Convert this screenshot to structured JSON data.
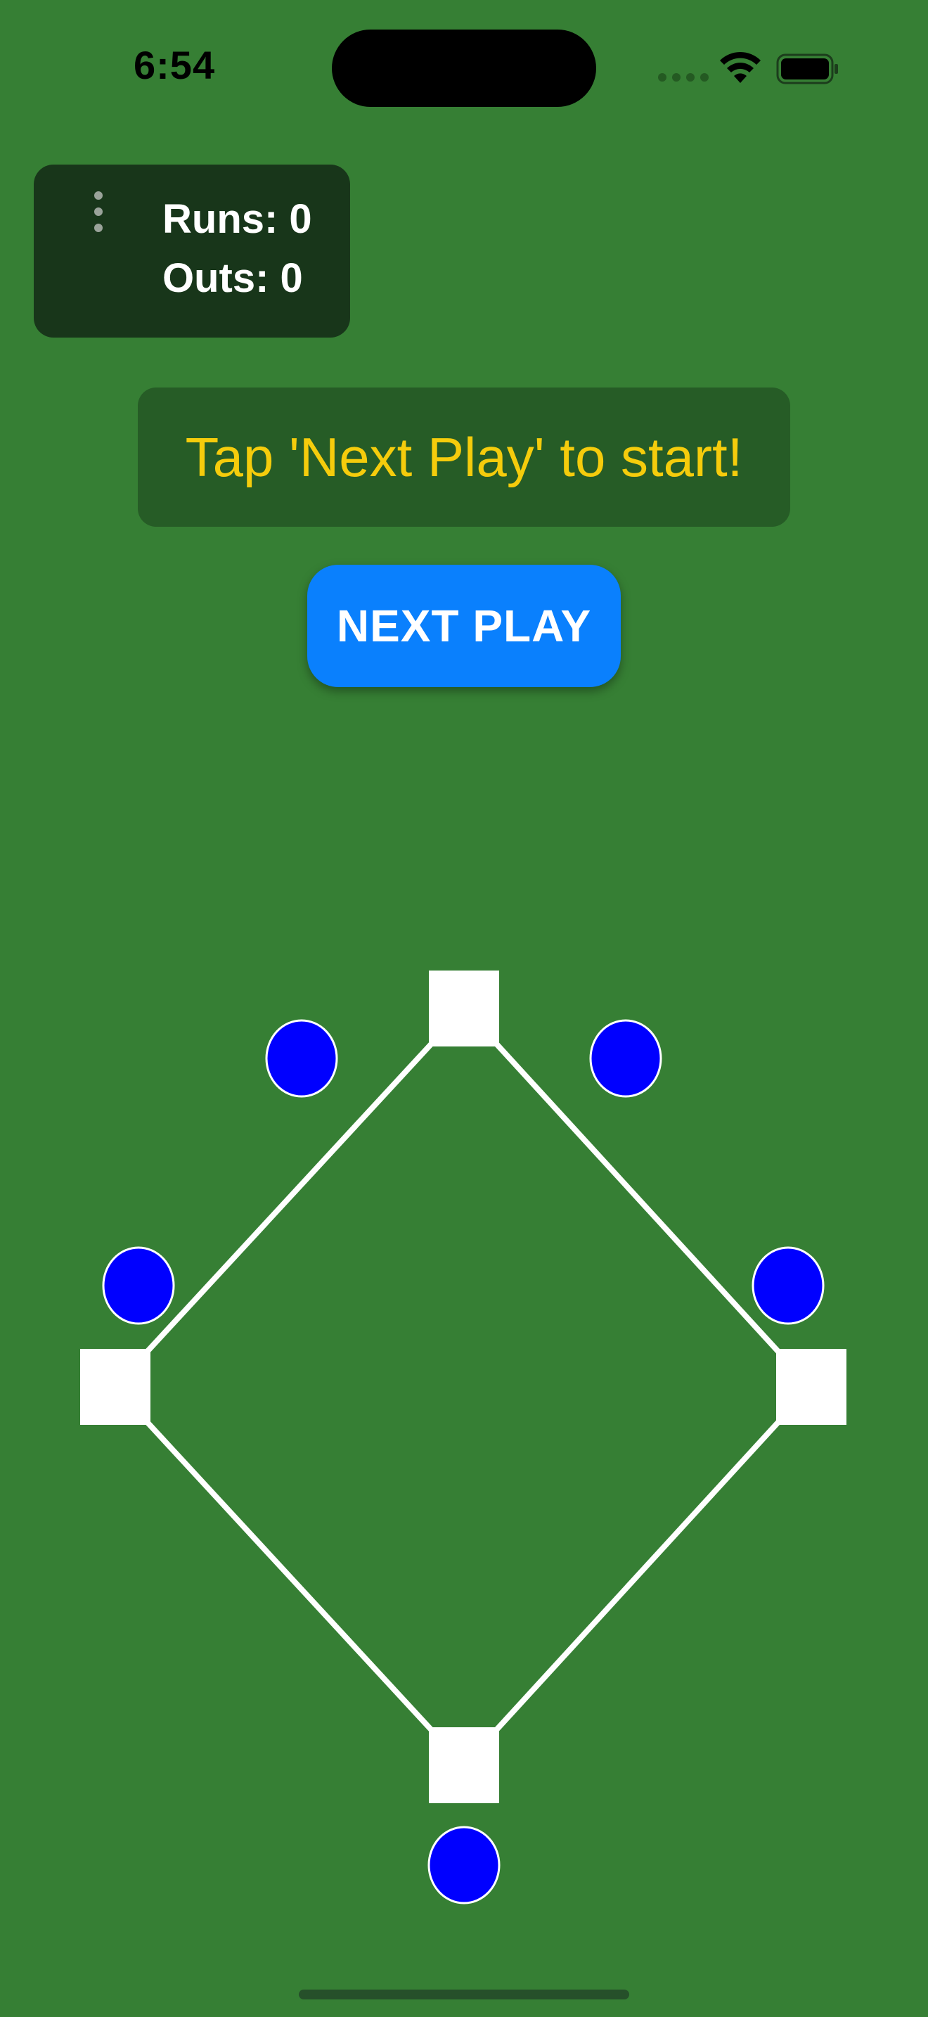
{
  "status_bar": {
    "time": "6:54"
  },
  "score_panel": {
    "runs_label": "Runs: 0",
    "outs_label": "Outs: 0",
    "runs": 0,
    "outs": 0,
    "menu_icon": "vertical-ellipsis-icon"
  },
  "message": {
    "text": "Tap 'Next Play' to start!"
  },
  "controls": {
    "next_play_label": "NEXT PLAY"
  },
  "field": {
    "bases": [
      "home",
      "first",
      "second",
      "third"
    ],
    "fielders": [
      "left-field",
      "center-left",
      "center-right",
      "right-field",
      "catcher"
    ]
  },
  "colors": {
    "field_green": "#367f34",
    "panel_dark": "#18361a",
    "message_bg": "#265c26",
    "message_text": "#f5cc0c",
    "button_blue": "#0a80fd",
    "fielder_blue": "#0000ff",
    "base_white": "#ffffff"
  }
}
